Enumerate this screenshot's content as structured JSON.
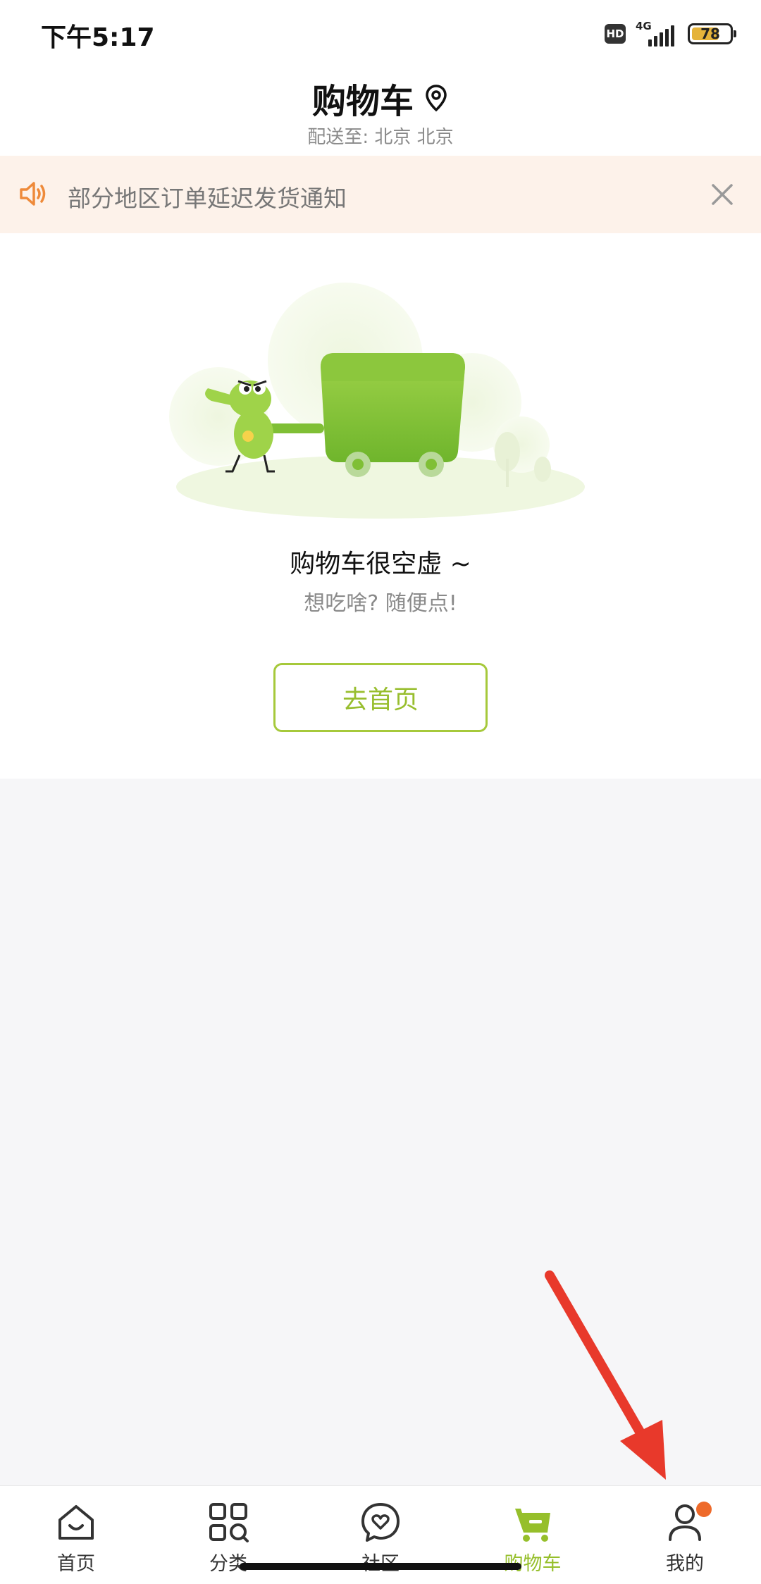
{
  "status_bar": {
    "time": "下午5:17",
    "hd": "HD",
    "network": "4G",
    "battery": "78"
  },
  "header": {
    "title": "购物车",
    "delivery": "配送至: 北京 北京"
  },
  "notice": {
    "text": "部分地区订单延迟发货通知"
  },
  "empty_state": {
    "title": "购物车很空虚 ~",
    "subtitle": "想吃啥? 随便点!",
    "button": "去首页"
  },
  "tabbar": {
    "tabs": [
      {
        "label": "首页",
        "icon": "home-icon"
      },
      {
        "label": "分类",
        "icon": "grid-search-icon"
      },
      {
        "label": "社区",
        "icon": "heart-chat-icon"
      },
      {
        "label": "购物车",
        "icon": "cart-icon"
      },
      {
        "label": "我的",
        "icon": "user-icon"
      }
    ],
    "active": "购物车"
  },
  "colors": {
    "accent": "#98be2e",
    "notice_bg": "#fdf2ea",
    "notice_icon": "#ee8a3a",
    "badge": "#ee6a2a",
    "annotation": "#e8392b"
  }
}
